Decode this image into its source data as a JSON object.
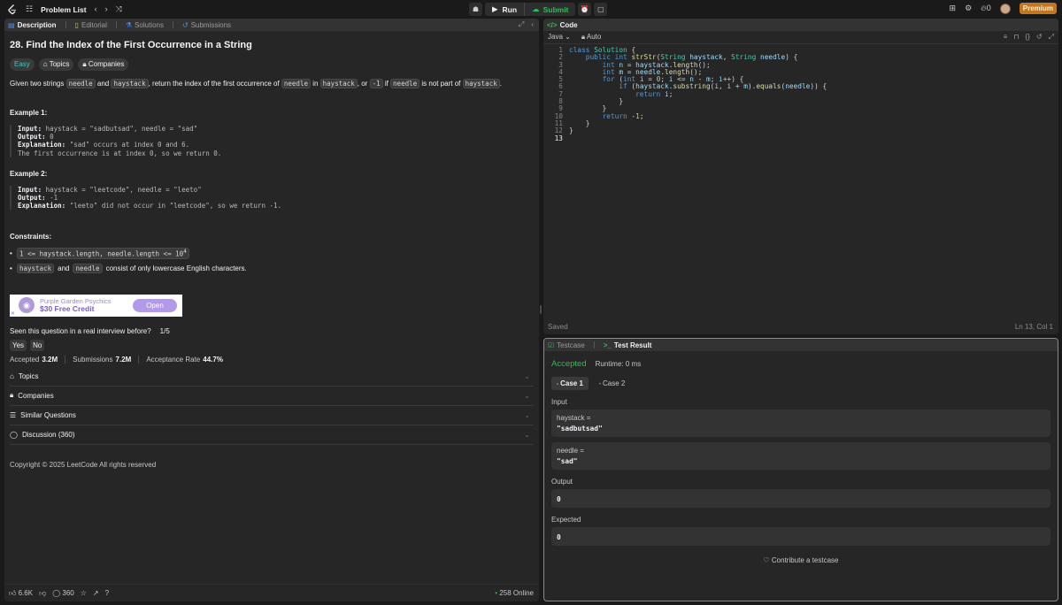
{
  "topbar": {
    "problem_list": "Problem List",
    "run": "Run",
    "submit": "Submit",
    "streak": "0",
    "premium": "Premium"
  },
  "left_tabs": {
    "description": "Description",
    "editorial": "Editorial",
    "solutions": "Solutions",
    "submissions": "Submissions"
  },
  "problem": {
    "title": "28. Find the Index of the First Occurrence in a String",
    "difficulty": "Easy",
    "topics": "Topics",
    "companies": "Companies",
    "desc_1": "Given two strings ",
    "needle": "needle",
    "and": " and ",
    "haystack": "haystack",
    "desc_2": ", return the index of the first occurrence of ",
    "in": " in ",
    "or": ", or ",
    "minus_one": "-1",
    "if": " if ",
    "desc_3": " is not part of ",
    "period": "."
  },
  "examples": [
    {
      "title": "Example 1:",
      "input_label": "Input:",
      "input": " haystack = \"sadbutsad\", needle = \"sad\"",
      "output_label": "Output:",
      "output": " 0",
      "expl_label": "Explanation:",
      "expl": " \"sad\" occurs at index 0 and 6.",
      "expl2": "The first occurrence is at index 0, so we return 0."
    },
    {
      "title": "Example 2:",
      "input_label": "Input:",
      "input": " haystack = \"leetcode\", needle = \"leeto\"",
      "output_label": "Output:",
      "output": " -1",
      "expl_label": "Explanation:",
      "expl": " \"leeto\" did not occur in \"leetcode\", so we return -1."
    }
  ],
  "constraints": {
    "title": "Constraints:",
    "c1": "1 <= haystack.length, needle.length <= 10",
    "c1_sup": "4",
    "c2_a": "haystack",
    "c2_and": " and ",
    "c2_b": "needle",
    "c2_rest": " consist of only lowercase English characters."
  },
  "ad": {
    "line1": "Purple Garden Psychics",
    "line2": "$30 Free Credit",
    "button": "Open",
    "close": "✕"
  },
  "interview": {
    "question": "Seen this question in a real interview before?",
    "pager": "1/5",
    "yes": "Yes",
    "no": "No"
  },
  "stats": {
    "accepted_label": "Accepted",
    "accepted": "3.2M",
    "submissions_label": "Submissions",
    "submissions": "7.2M",
    "rate_label": "Acceptance Rate",
    "rate": "44.7%"
  },
  "accordion": [
    {
      "label": "Topics"
    },
    {
      "label": "Companies"
    },
    {
      "label": "Similar Questions"
    },
    {
      "label": "Discussion (360)"
    }
  ],
  "copyright": {
    "text": "Copyright",
    "rest": "2025 LeetCode All rights reserved"
  },
  "footer": {
    "likes": "6.6K",
    "comments": "360",
    "online": "258 Online"
  },
  "code": {
    "tab": "Code",
    "language": "Java",
    "auto": "Auto",
    "saved": "Saved",
    "cursor": "Ln 13, Col 1",
    "line_numbers": [
      "1",
      "2",
      "3",
      "4",
      "5",
      "6",
      "7",
      "8",
      "9",
      "10",
      "11",
      "12",
      "13"
    ]
  },
  "result_tabs": {
    "testcase": "Testcase",
    "test_result": "Test Result"
  },
  "result": {
    "status": "Accepted",
    "runtime": "Runtime: 0 ms",
    "case1": "Case 1",
    "case2": "Case 2",
    "input_label": "Input",
    "haystack_key": "haystack =",
    "haystack_val": "\"sadbutsad\"",
    "needle_key": "needle =",
    "needle_val": "\"sad\"",
    "output_label": "Output",
    "output_val": "0",
    "expected_label": "Expected",
    "expected_val": "0",
    "contribute": "Contribute a testcase"
  },
  "colors": {
    "accent_green": "#2cbb5d",
    "easy_teal": "#46c6c2",
    "premium": "#c2761f",
    "link_blue": "#4c8ef7"
  }
}
